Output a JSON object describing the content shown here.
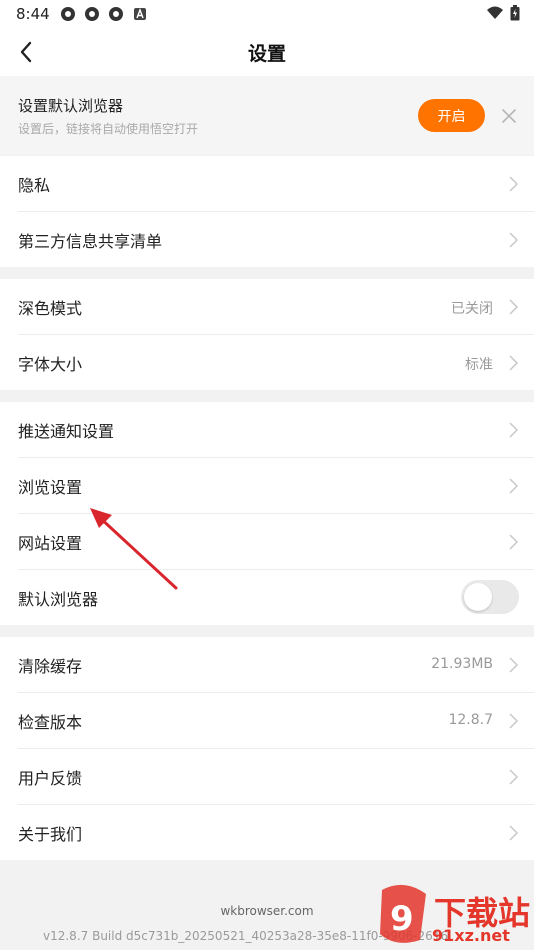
{
  "status_bar": {
    "time": "8:44",
    "left_icons": [
      "app-circle-icon",
      "app-circle-icon",
      "app-circle-icon",
      "a-badge-icon"
    ],
    "right_icons": [
      "wifi-icon",
      "battery-icon"
    ]
  },
  "nav": {
    "title": "设置",
    "back_icon": "chevron-left-icon"
  },
  "banner": {
    "title": "设置默认浏览器",
    "subtitle": "设置后，链接将自动使用悟空打开",
    "button_label": "开启",
    "close_icon": "close-icon",
    "accent": "#ff7300"
  },
  "groups": [
    {
      "rows": [
        {
          "label": "隐私",
          "value": ""
        },
        {
          "label": "第三方信息共享清单",
          "value": ""
        }
      ]
    },
    {
      "rows": [
        {
          "label": "深色模式",
          "value": "已关闭"
        },
        {
          "label": "字体大小",
          "value": "标准"
        }
      ]
    },
    {
      "rows": [
        {
          "label": "推送通知设置",
          "value": ""
        },
        {
          "label": "浏览设置",
          "value": ""
        },
        {
          "label": "网站设置",
          "value": ""
        },
        {
          "label": "默认浏览器",
          "value": "",
          "toggle": "off"
        }
      ]
    },
    {
      "rows": [
        {
          "label": "清除缓存",
          "value": "21.93MB"
        },
        {
          "label": "检查版本",
          "value": "12.8.7"
        },
        {
          "label": "用户反馈",
          "value": ""
        },
        {
          "label": "关于我们",
          "value": ""
        }
      ]
    }
  ],
  "footer": {
    "site": "wkbrowser.com",
    "build": "v12.8.7 Build d5c731b_20250521_40253a28-35e8-11f0-9906-2616"
  },
  "watermark": {
    "text": "下载站",
    "sub": "91xz.net",
    "color": "#e4362b"
  }
}
